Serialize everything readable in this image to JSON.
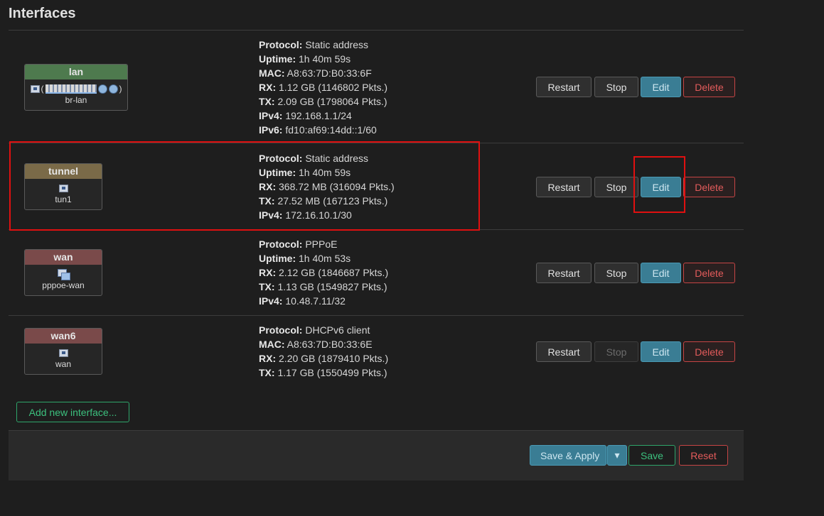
{
  "page": {
    "title": "Interfaces"
  },
  "colors": {
    "lan": "#4e7a4e",
    "tunnel": "#7a6a48",
    "wan": "#7a4a4a",
    "wan6": "#7a4a4a",
    "highlight": "#e01010"
  },
  "interfaces": [
    {
      "name": "lan",
      "device": "br-lan",
      "fields": [
        {
          "label": "Protocol:",
          "value": "Static address"
        },
        {
          "label": "Uptime:",
          "value": "1h 40m 59s"
        },
        {
          "label": "MAC:",
          "value": "A8:63:7D:B0:33:6F"
        },
        {
          "label": "RX:",
          "value": "1.12 GB (1146802 Pkts.)"
        },
        {
          "label": "TX:",
          "value": "2.09 GB (1798064 Pkts.)"
        },
        {
          "label": "IPv4:",
          "value": "192.168.1.1/24"
        },
        {
          "label": "IPv6:",
          "value": "fd10:af69:14dd::1/60"
        }
      ]
    },
    {
      "name": "tunnel",
      "device": "tun1",
      "fields": [
        {
          "label": "Protocol:",
          "value": "Static address"
        },
        {
          "label": "Uptime:",
          "value": "1h 40m 59s"
        },
        {
          "label": "RX:",
          "value": "368.72 MB (316094 Pkts.)"
        },
        {
          "label": "TX:",
          "value": "27.52 MB (167123 Pkts.)"
        },
        {
          "label": "IPv4:",
          "value": "172.16.10.1/30"
        }
      ]
    },
    {
      "name": "wan",
      "device": "pppoe-wan",
      "fields": [
        {
          "label": "Protocol:",
          "value": "PPPoE"
        },
        {
          "label": "Uptime:",
          "value": "1h 40m 53s"
        },
        {
          "label": "RX:",
          "value": "2.12 GB (1846687 Pkts.)"
        },
        {
          "label": "TX:",
          "value": "1.13 GB (1549827 Pkts.)"
        },
        {
          "label": "IPv4:",
          "value": "10.48.7.11/32"
        }
      ]
    },
    {
      "name": "wan6",
      "device": "wan",
      "fields": [
        {
          "label": "Protocol:",
          "value": "DHCPv6 client"
        },
        {
          "label": "MAC:",
          "value": "A8:63:7D:B0:33:6E"
        },
        {
          "label": "RX:",
          "value": "2.20 GB (1879410 Pkts.)"
        },
        {
          "label": "TX:",
          "value": "1.17 GB (1550499 Pkts.)"
        }
      ]
    }
  ],
  "buttons": {
    "restart": "Restart",
    "stop": "Stop",
    "edit": "Edit",
    "delete": "Delete"
  },
  "add_interface": "Add new interface...",
  "footer": {
    "save_apply": "Save & Apply",
    "dropdown": "▾",
    "save": "Save",
    "reset": "Reset"
  },
  "icons": {
    "lan": "bridge-icon",
    "tunnel": "tunnel-icon",
    "wan": "pppoe-icon",
    "wan6": "ethernet-icon"
  }
}
